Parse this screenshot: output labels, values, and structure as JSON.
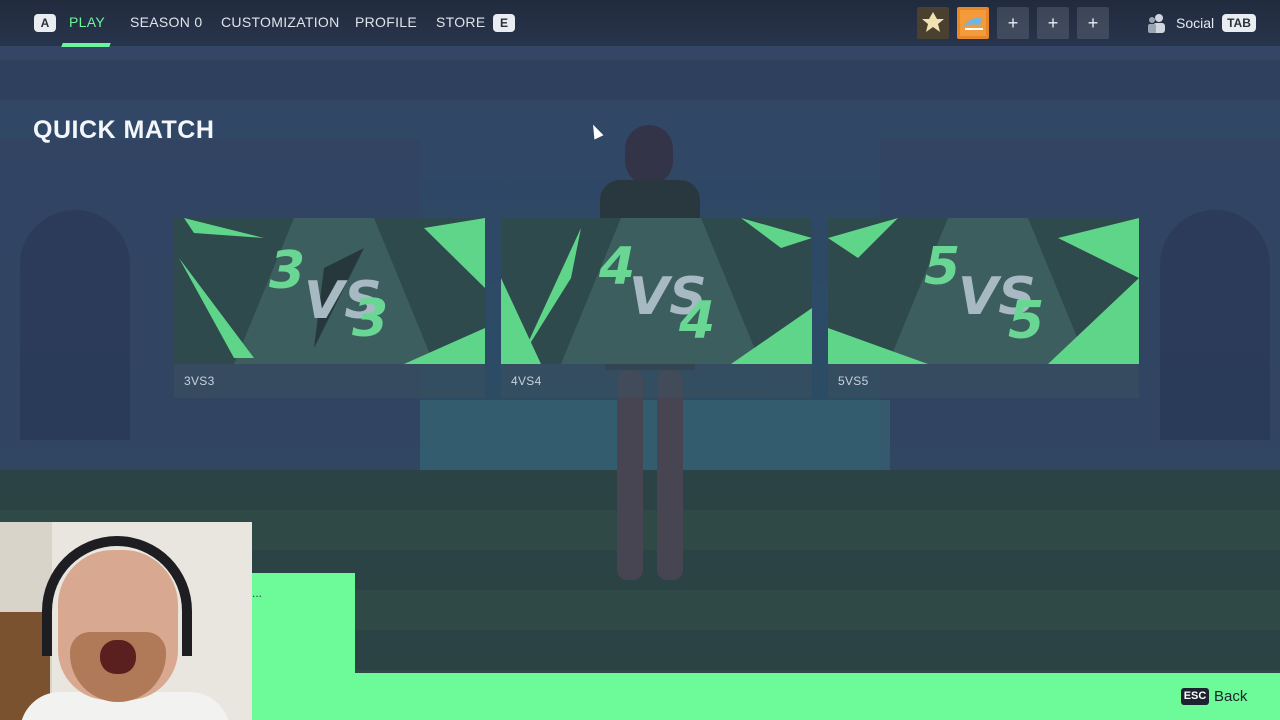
{
  "nav": {
    "left_key": "A",
    "right_key": "E",
    "items": [
      {
        "label": "PLAY",
        "active": true
      },
      {
        "label": "SEASON 0",
        "active": false
      },
      {
        "label": "CUSTOMIZATION",
        "active": false
      },
      {
        "label": "PROFILE",
        "active": false
      },
      {
        "label": "STORE",
        "active": false
      }
    ],
    "accent_color": "#6cf59a"
  },
  "party": {
    "slots": [
      {
        "type": "rank-badge-icon"
      },
      {
        "type": "player-avatar-icon"
      },
      {
        "type": "add",
        "label": "+"
      },
      {
        "type": "add",
        "label": "+"
      },
      {
        "type": "add",
        "label": "+"
      }
    ]
  },
  "social": {
    "label": "Social",
    "key": "TAB"
  },
  "page": {
    "title": "QUICK MATCH"
  },
  "modes": [
    {
      "label": "3VS3",
      "art_left": "3",
      "art_vs": "VS",
      "art_right": "3"
    },
    {
      "label": "4VS4",
      "art_left": "4",
      "art_vs": "VS",
      "art_right": "4"
    },
    {
      "label": "5VS5",
      "art_left": "5",
      "art_vs": "VS",
      "art_right": "5"
    }
  ],
  "footer": {
    "esc_key": "ESC",
    "back_label": "Back"
  },
  "overlay": {
    "ellipsis": "..."
  }
}
